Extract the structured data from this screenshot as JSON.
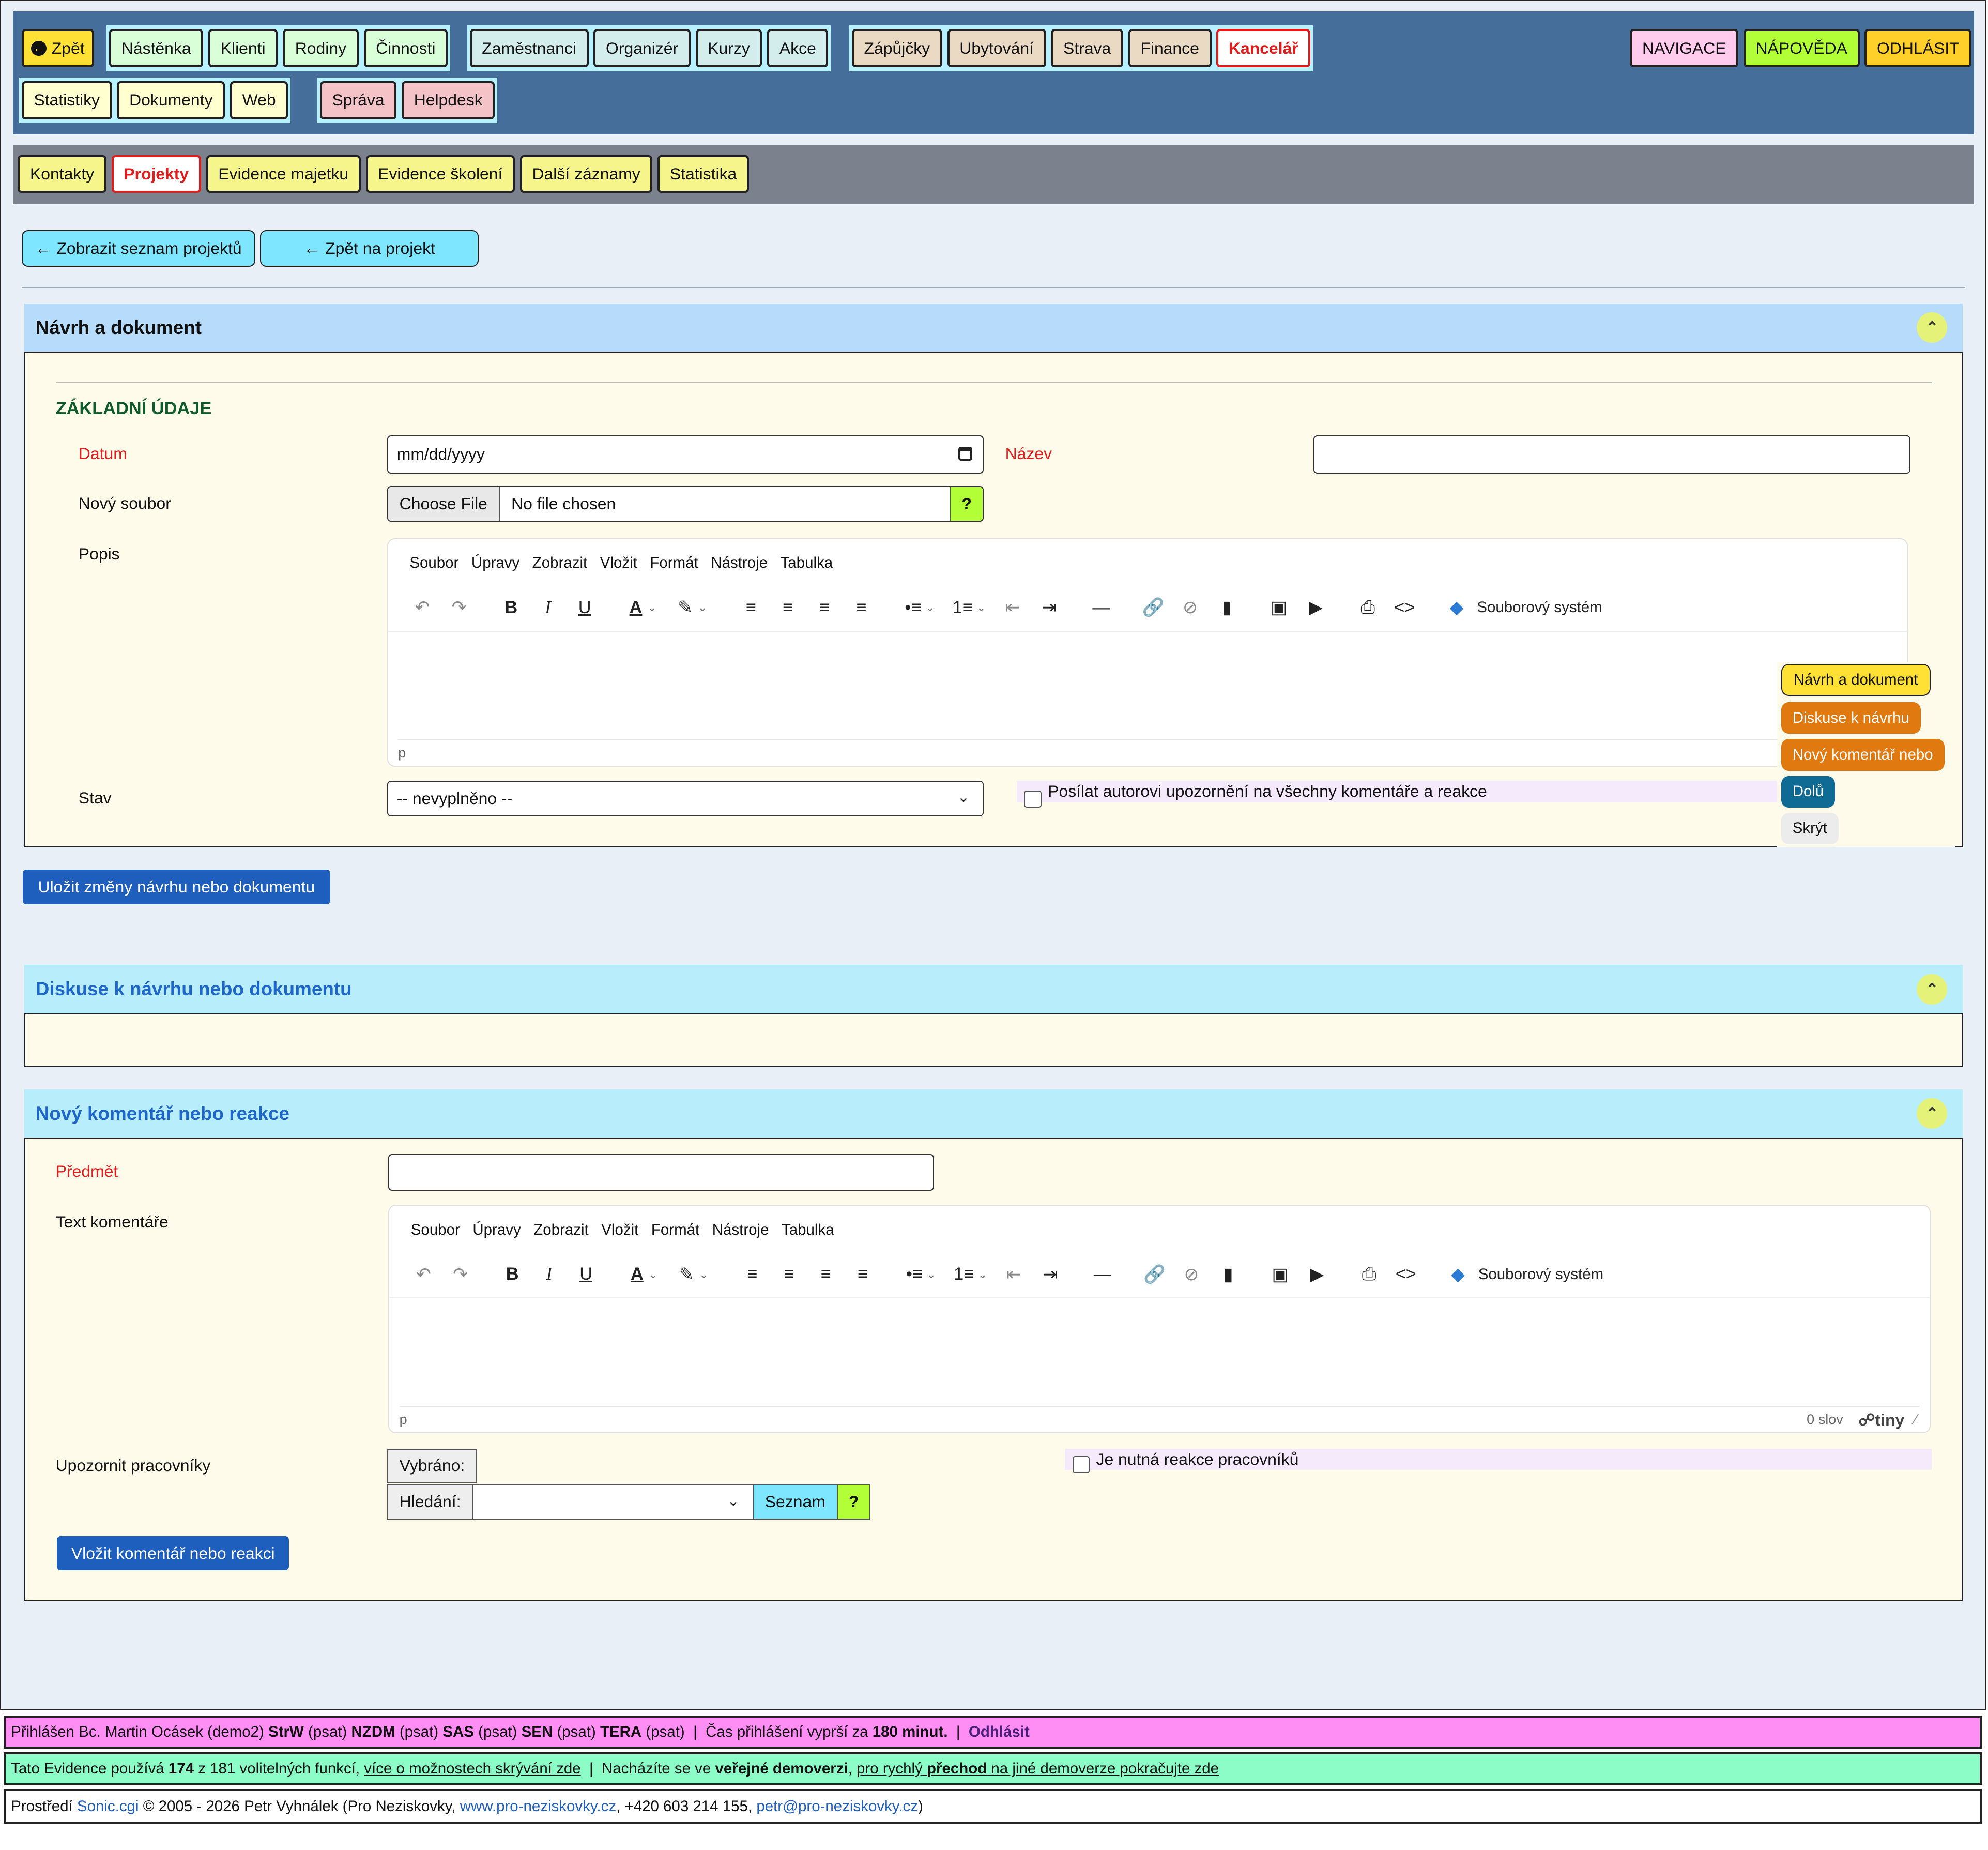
{
  "topnav": {
    "back": "Zpět",
    "group1": [
      "Nástěnka",
      "Klienti",
      "Rodiny",
      "Činnosti"
    ],
    "group2": [
      "Zaměstnanci",
      "Organizér",
      "Kurzy",
      "Akce"
    ],
    "group3": [
      "Zápůjčky",
      "Ubytování",
      "Strava",
      "Finance"
    ],
    "active": "Kancelář",
    "group4": [
      "Statistiky",
      "Dokumenty",
      "Web"
    ],
    "group5": [
      "Správa",
      "Helpdesk"
    ],
    "right": [
      "NAVIGACE",
      "NÁPOVĚDA",
      "ODHLÁSIT"
    ]
  },
  "subnav": {
    "items": [
      "Kontakty",
      "Projekty",
      "Evidence majetku",
      "Evidence školení",
      "Další záznamy",
      "Statistika"
    ]
  },
  "actions": {
    "list": "Zobrazit seznam projektů",
    "back_project": "Zpět na projekt"
  },
  "section1": {
    "title": "Návrh a dokument",
    "subheading": "ZÁKLADNÍ ÚDAJE",
    "date_label": "Datum",
    "date_placeholder": "mm/dd/yyyy",
    "name_label": "Název",
    "file_label": "Nový soubor",
    "file_button": "Choose File",
    "file_status": "No file chosen",
    "help": "?",
    "desc_label": "Popis",
    "state_label": "Stav",
    "state_value": "-- nevyplněno --",
    "notify_label": "Posílat autorovi upozornění na všechny komentáře a reakce",
    "editor_status": "p",
    "save_button": "Uložit změny návrhu nebo dokumentu"
  },
  "editor_menu": [
    "Soubor",
    "Úpravy",
    "Zobrazit",
    "Vložit",
    "Formát",
    "Nástroje",
    "Tabulka"
  ],
  "editor_filesystem": "Souborový systém",
  "floating_menu": {
    "items": [
      "Návrh a dokument",
      "Diskuse k návrhu",
      "Nový komentář nebo",
      "Dolů",
      "Skrýt"
    ],
    "colors": [
      "#ffe135",
      "#e07a10",
      "#e07a10",
      "#0f6a94",
      "#ececec"
    ]
  },
  "section2": {
    "title": "Diskuse k návrhu nebo dokumentu"
  },
  "section3": {
    "title": "Nový komentář nebo reakce",
    "subject_label": "Předmět",
    "text_label": "Text komentáře",
    "editor_status": "p",
    "word_count": "0 slov",
    "tiny_brand": "tiny",
    "notify_workers_label": "Upozornit pracovníky",
    "selected_label": "Vybráno:",
    "search_label": "Hledání:",
    "list_button": "Seznam",
    "help": "?",
    "reaction_label": "Je nutná reakce pracovníků",
    "submit_button": "Vložit komentář nebo reakci"
  },
  "footer": {
    "line1_prefix": "Přihlášen Bc. Martin Ocásek (demo2)",
    "line1_roles": [
      {
        "code": "StrW",
        "mode": "(psat)"
      },
      {
        "code": "NZDM",
        "mode": "(psat)"
      },
      {
        "code": "SAS",
        "mode": "(psat)"
      },
      {
        "code": "SEN",
        "mode": "(psat)"
      },
      {
        "code": "TERA",
        "mode": "(psat)"
      }
    ],
    "line1_timeout_prefix": "Čas přihlášení vyprší za",
    "line1_timeout_value": "180 minut.",
    "line1_logout": "Odhlásit",
    "line2_prefix": "Tato Evidence používá",
    "line2_count": "174",
    "line2_total": "z 181 volitelných funkcí,",
    "line2_link": "více o možnostech skrývání zde",
    "line2_mid": "Nacházíte se ve",
    "line2_mode": "veřejné demoverzi",
    "line2_link2_a": "pro rychlý",
    "line2_link2_b": "přechod",
    "line2_link2_c": "na jiné demoverze pokračujte zde",
    "line3_prefix": "Prostředí",
    "line3_sonic": "Sonic.cgi",
    "line3_copy": "© 2005 - 2026 Petr Vyhnálek (Pro Neziskovky,",
    "line3_web": "www.pro-neziskovky.cz",
    "line3_phone": ", +420 603 214 155,",
    "line3_mail": "petr@pro-neziskovky.cz",
    "line3_end": ")"
  }
}
